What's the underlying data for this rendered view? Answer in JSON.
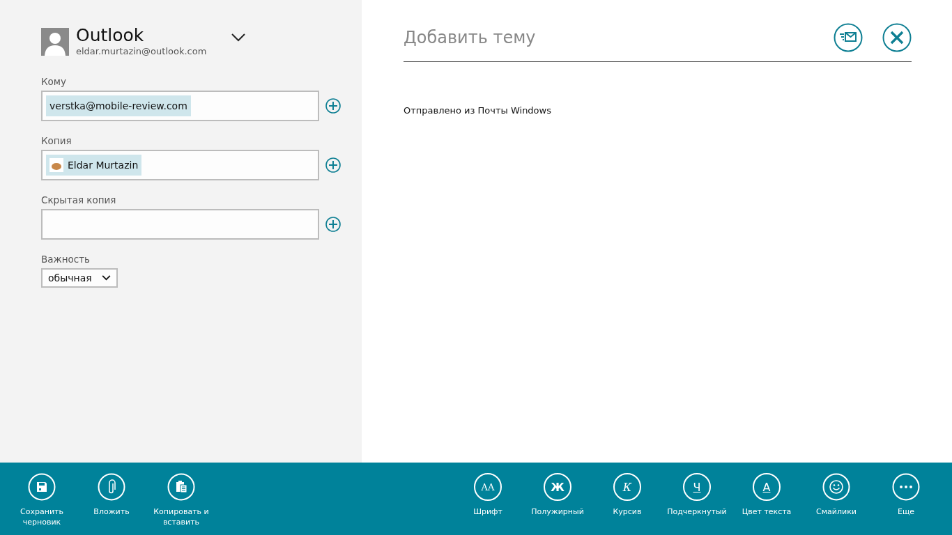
{
  "account": {
    "name": "Outlook",
    "email": "eldar.murtazin@outlook.com"
  },
  "recipient_fields": [
    {
      "label": "Кому",
      "recipients": [
        {
          "kind": "address",
          "text": "verstka@mobile-review.com"
        }
      ]
    },
    {
      "label": "Копия",
      "recipients": [
        {
          "kind": "contact",
          "text": "Eldar Murtazin"
        }
      ]
    },
    {
      "label": "Скрытая копия"
    }
  ],
  "importance": {
    "label": "Важность",
    "value": "обычная"
  },
  "subject": {
    "placeholder": "Добавить тему"
  },
  "body": "Отправлено из Почты Windows",
  "app_bar": {
    "left": [
      {
        "kind": "save",
        "label": "Сохранить черновик"
      },
      {
        "kind": "paperclip",
        "label": "Вложить"
      },
      {
        "kind": "clipboard",
        "label": "Копировать и вставить"
      }
    ],
    "right": [
      {
        "kind": "font",
        "glyph": "AA",
        "label": "Шрифт"
      },
      {
        "kind": "bold",
        "glyph": "Ж",
        "label": "Полужирный"
      },
      {
        "kind": "italic",
        "glyph": "К",
        "label": "Курсив"
      },
      {
        "kind": "underline",
        "glyph": "Ч",
        "label": "Подчеркнутый"
      },
      {
        "kind": "underline",
        "glyph": "A",
        "label": "Цвет текста"
      },
      {
        "kind": "smiley",
        "label": "Смайлики"
      },
      {
        "kind": "dots",
        "label": "Еще"
      }
    ]
  }
}
